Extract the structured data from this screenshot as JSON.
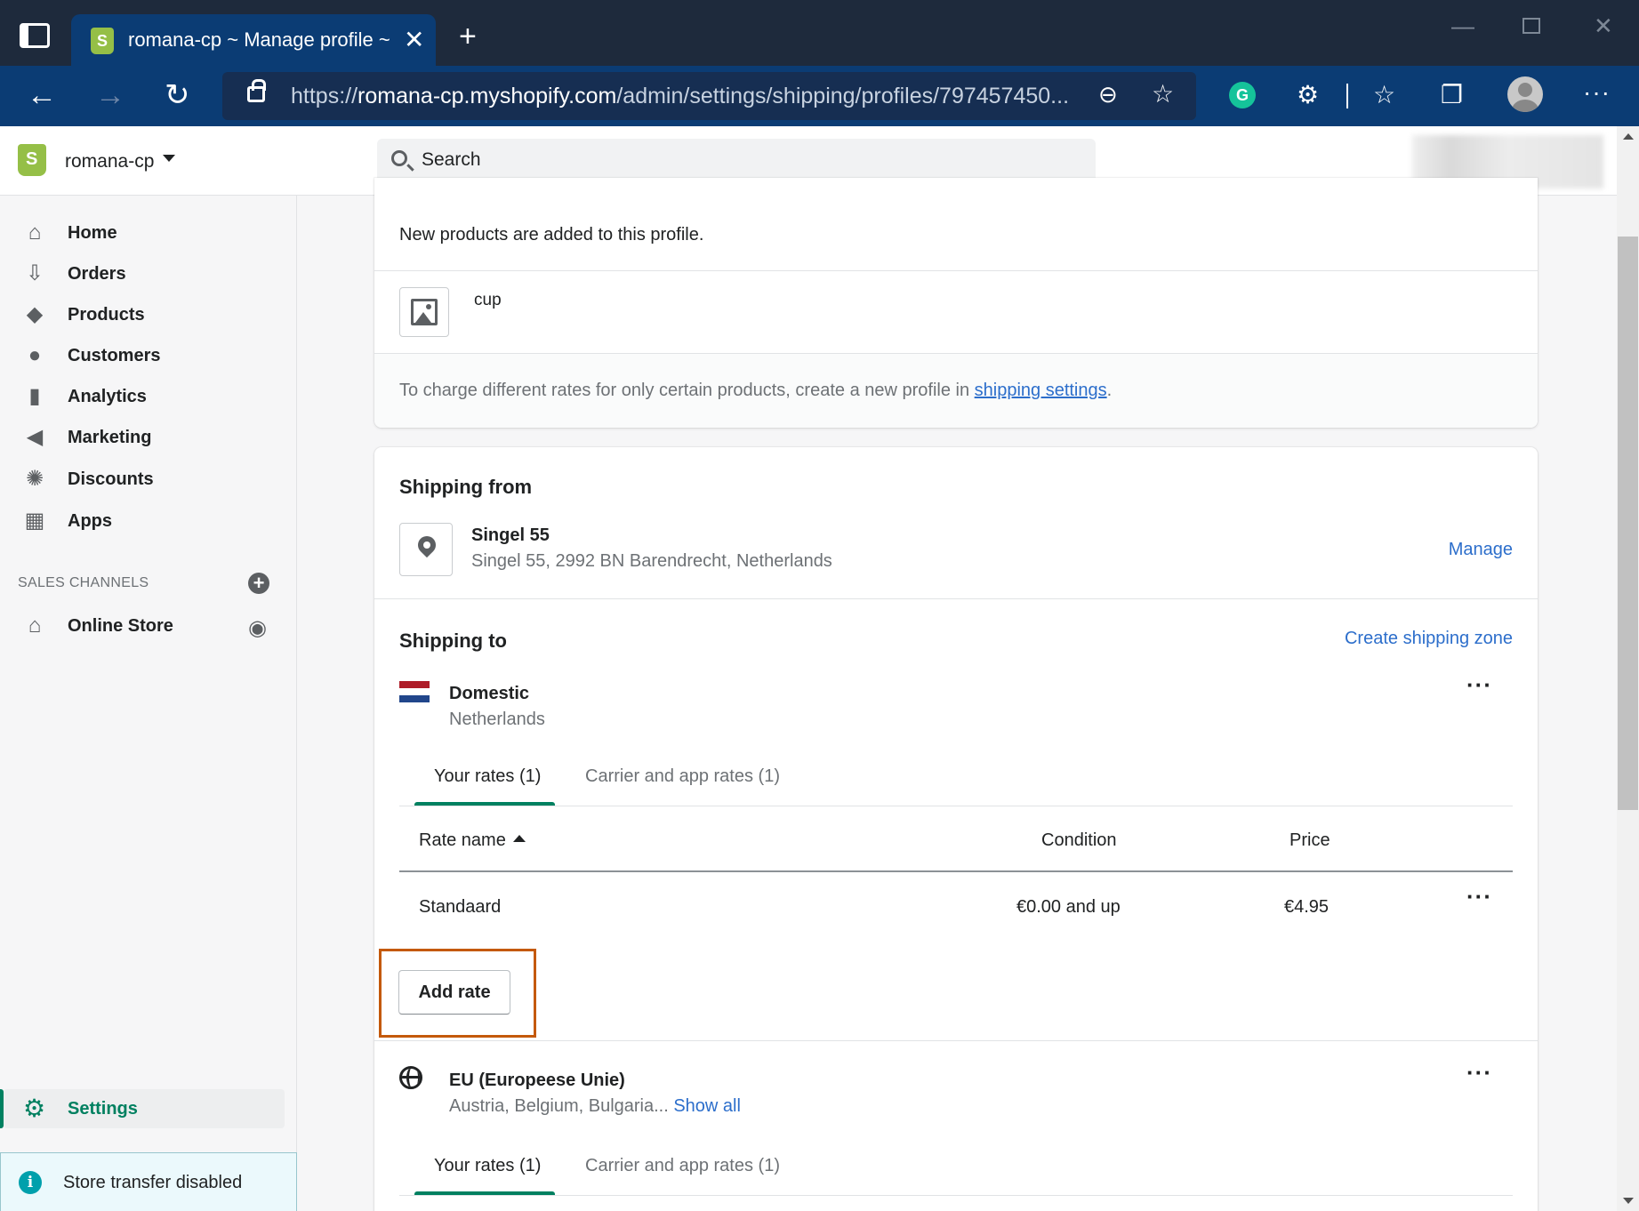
{
  "browser": {
    "tab_title": "romana-cp ~ Manage profile ~ S",
    "url_prefix": "https://",
    "url_host": "romana-cp.myshopify.com",
    "url_path": "/admin/settings/shipping/profiles/797457450...",
    "grammarly_letter": "G"
  },
  "topbar": {
    "store_name": "romana-cp",
    "search_placeholder": "Search"
  },
  "sidebar": {
    "items": [
      {
        "label": "Home",
        "icon": "home-icon"
      },
      {
        "label": "Orders",
        "icon": "orders-icon"
      },
      {
        "label": "Products",
        "icon": "tag-icon"
      },
      {
        "label": "Customers",
        "icon": "person-icon"
      },
      {
        "label": "Analytics",
        "icon": "bar-chart-icon"
      },
      {
        "label": "Marketing",
        "icon": "megaphone-icon"
      },
      {
        "label": "Discounts",
        "icon": "discount-icon"
      },
      {
        "label": "Apps",
        "icon": "apps-icon"
      }
    ],
    "sales_channels_heading": "SALES CHANNELS",
    "online_store": "Online Store",
    "settings": "Settings",
    "store_transfer": "Store transfer disabled"
  },
  "profile_card": {
    "new_products_note": "New products are added to this profile.",
    "product_name": "cup",
    "charge_note_prefix": "To charge different rates for only certain products, create a new profile in ",
    "charge_note_link": "shipping settings",
    "charge_note_suffix": "."
  },
  "shipping_from": {
    "heading": "Shipping from",
    "location_name": "Singel 55",
    "location_address": "Singel 55, 2992 BN Barendrecht, Netherlands",
    "manage_link": "Manage"
  },
  "shipping_to": {
    "heading": "Shipping to",
    "create_zone_link": "Create shipping zone",
    "zones": [
      {
        "name": "Domestic",
        "countries": "Netherlands",
        "tabs": [
          "Your rates (1)",
          "Carrier and app rates (1)"
        ],
        "table": {
          "headers": [
            "Rate name",
            "Condition",
            "Price"
          ],
          "rows": [
            {
              "name": "Standaard",
              "condition": "€0.00 and up",
              "price": "€4.95"
            }
          ]
        },
        "add_rate_label": "Add rate"
      },
      {
        "name": "EU (Europeese Unie)",
        "countries": "Austria, Belgium, Bulgaria...",
        "show_all": "Show all",
        "tabs": [
          "Your rates (1)",
          "Carrier and app rates (1)"
        ]
      }
    ]
  },
  "colors": {
    "accent_green": "#008060",
    "link_blue": "#2c6ecb",
    "highlight_box": "#c4590b",
    "browser_chrome": "#0b3c74",
    "flag_red": "#ae1c28",
    "flag_blue": "#21468b"
  }
}
